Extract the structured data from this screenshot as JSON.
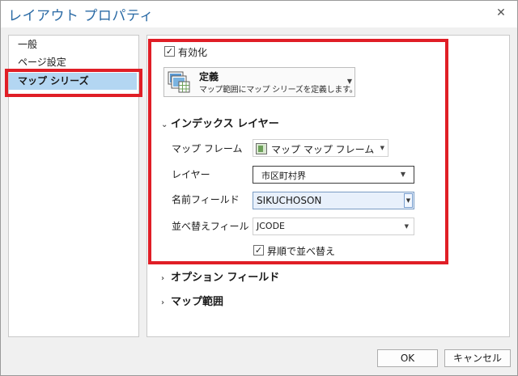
{
  "window": {
    "title": "レイアウト プロパティ",
    "close_glyph": "✕"
  },
  "nav": {
    "items": [
      {
        "label": "一般"
      },
      {
        "label": "ページ設定"
      },
      {
        "label": "マップ シリーズ",
        "selected": true
      }
    ]
  },
  "map_series": {
    "enabled_label": "有効化",
    "enabled": true,
    "definition": {
      "title": "定義",
      "description": "マップ範囲にマップ シリーズを定義します。"
    },
    "index_layer_section": {
      "title": "インデックス レイヤー",
      "expanded": true,
      "map_frame_label": "マップ フレーム",
      "map_frame_value": "マップ マップ フレーム",
      "layer_label": "レイヤー",
      "layer_value": "市区町村界",
      "name_field_label": "名前フィールド",
      "name_field_value": "SIKUCHOSON",
      "sort_field_label": "並べ替えフィール",
      "sort_field_value": "JCODE",
      "ascending_label": "昇順で並べ替え",
      "ascending": true
    },
    "option_fields_section": {
      "title": "オプション フィールド",
      "expanded": false
    },
    "map_extent_section": {
      "title": "マップ範囲",
      "expanded": false
    }
  },
  "buttons": {
    "ok": "OK",
    "cancel": "キャンセル"
  },
  "colors": {
    "highlight_red": "#e01e26",
    "title_blue": "#2a6aa5",
    "selected_bg": "#b3d6f2"
  },
  "glyphs": {
    "check": "✓",
    "chev_down": "⌄",
    "chev_right": "›",
    "dropdown_arrow": "▼"
  }
}
